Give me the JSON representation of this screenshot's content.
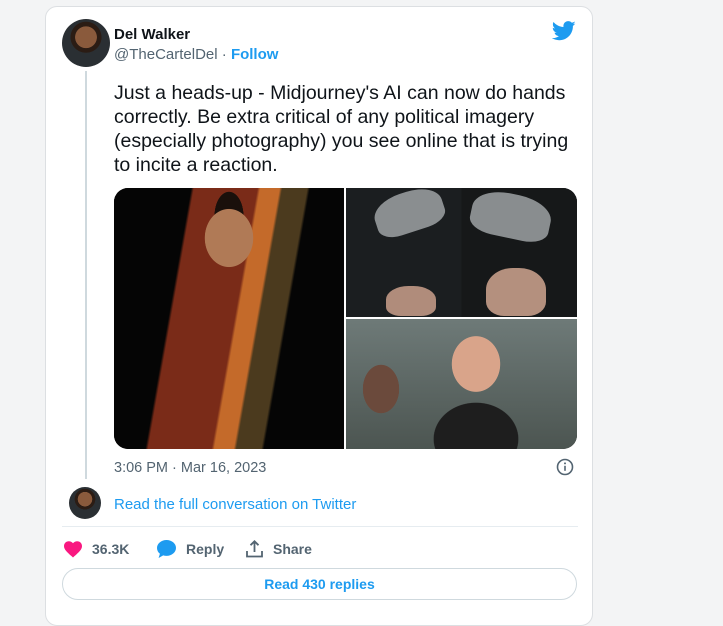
{
  "tweet": {
    "author_name": "Del Walker",
    "handle": "@TheCartelDel",
    "separator": " · ",
    "follow_label": "Follow",
    "text": "Just a heads-up - Midjourney's AI can now do hands correctly. Be extra critical of any political imagery (especially photography) you see online that is trying to incite a reaction.",
    "timestamp": "3:06 PM · Mar 16, 2023",
    "read_conversation": "Read the full conversation on Twitter",
    "like_count": "36.3K",
    "reply_label": "Reply",
    "share_label": "Share",
    "read_replies_label": "Read 430 replies"
  },
  "colors": {
    "brand": "#1d9bf0",
    "like": "#f91880",
    "secondary_text": "#536471"
  },
  "icons": [
    "twitter-bird-icon",
    "info-icon",
    "heart-icon",
    "reply-icon",
    "share-icon"
  ]
}
